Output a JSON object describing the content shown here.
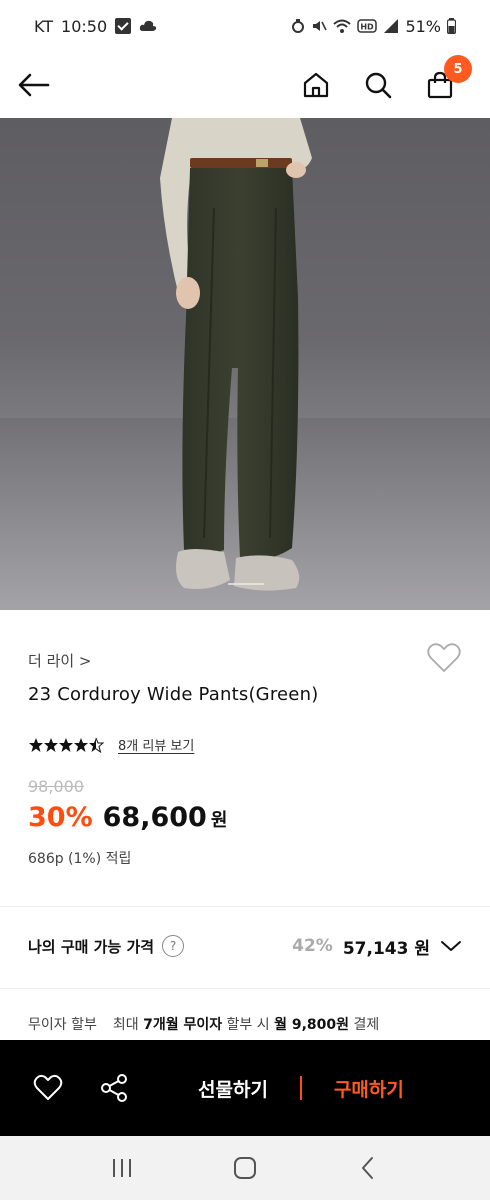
{
  "status_bar": {
    "carrier": "KT",
    "time": "10:50",
    "battery": "51%"
  },
  "nav": {
    "cart_count": "5",
    "icons": [
      "back-arrow-icon",
      "home-icon",
      "search-icon",
      "shopping-bag-icon"
    ]
  },
  "product": {
    "brand": "더 라이 >",
    "title": "23 Corduroy Wide Pants(Green)",
    "rating": 4.5,
    "review_link": "8개 리뷰 보기",
    "original_price": "98,000",
    "discount": "30%",
    "price": "68,600",
    "currency": "원",
    "points": "686p (1%) 적립"
  },
  "my_price": {
    "label": "나의 구매 가능 가격",
    "help": "?",
    "discount": "42%",
    "price": "57,143 원"
  },
  "installment": {
    "label": "무이자 할부",
    "detail_prefix": "최대 ",
    "detail_months": "7개월 무이자",
    "detail_mid": " 할부 시 ",
    "detail_amount": "월 9,800원",
    "detail_suffix": " 결제"
  },
  "actions": {
    "gift": "선물하기",
    "buy": "구매하기"
  },
  "colors": {
    "accent": "#ff4d0f",
    "badge": "#ff5a1f",
    "bar": "#000000"
  }
}
